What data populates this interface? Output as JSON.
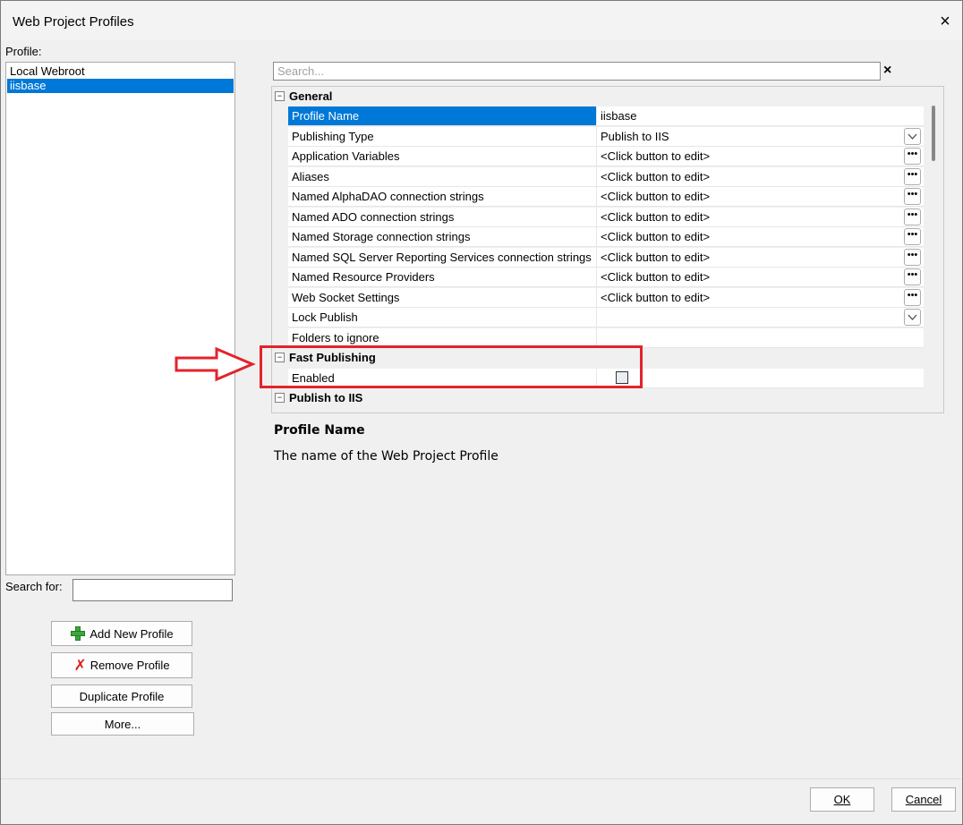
{
  "window": {
    "title": "Web Project Profiles",
    "close_icon": "×"
  },
  "profiles": {
    "label": "Profile:",
    "items": [
      {
        "label": "Local Webroot",
        "selected": false
      },
      {
        "label": "iisbase",
        "selected": true
      }
    ],
    "search_label": "Search for:",
    "search_value": ""
  },
  "buttons": {
    "add_profile": "Add New Profile",
    "remove_profile": "Remove Profile",
    "duplicate_profile": "Duplicate Profile",
    "more": "More..."
  },
  "properties": {
    "search_placeholder": "Search...",
    "clear_icon": "×",
    "categories": [
      {
        "label": "General",
        "rows": [
          {
            "name": "Profile Name",
            "value": "iisbase",
            "control": "none",
            "selected": true
          },
          {
            "name": "Publishing Type",
            "value": "Publish to IIS",
            "control": "dropdown"
          },
          {
            "name": "Application Variables",
            "value": "<Click button to edit>",
            "control": "ellipsis"
          },
          {
            "name": "Aliases",
            "value": "<Click button to edit>",
            "control": "ellipsis"
          },
          {
            "name": "Named AlphaDAO connection strings",
            "value": "<Click button to edit>",
            "control": "ellipsis"
          },
          {
            "name": "Named ADO connection strings",
            "value": "<Click button to edit>",
            "control": "ellipsis"
          },
          {
            "name": "Named Storage connection strings",
            "value": "<Click button to edit>",
            "control": "ellipsis"
          },
          {
            "name": "Named SQL Server Reporting Services connection strings",
            "value": "<Click button to edit>",
            "control": "ellipsis"
          },
          {
            "name": "Named Resource Providers",
            "value": "<Click button to edit>",
            "control": "ellipsis"
          },
          {
            "name": "Web Socket Settings",
            "value": "<Click button to edit>",
            "control": "ellipsis"
          },
          {
            "name": "Lock Publish",
            "value": "",
            "control": "dropdown"
          },
          {
            "name": "Folders to ignore",
            "value": "",
            "control": "none"
          }
        ]
      },
      {
        "label": "Fast Publishing",
        "rows": [
          {
            "name": "Enabled",
            "value": "",
            "control": "checkbox",
            "checked": false
          }
        ]
      },
      {
        "label": "Publish to IIS",
        "rows": []
      }
    ]
  },
  "description": {
    "title": "Profile Name",
    "text": "The name of the Web Project Profile"
  },
  "footer": {
    "ok": "OK",
    "cancel": "Cancel"
  },
  "annotation": {
    "color": "#e3232c"
  }
}
